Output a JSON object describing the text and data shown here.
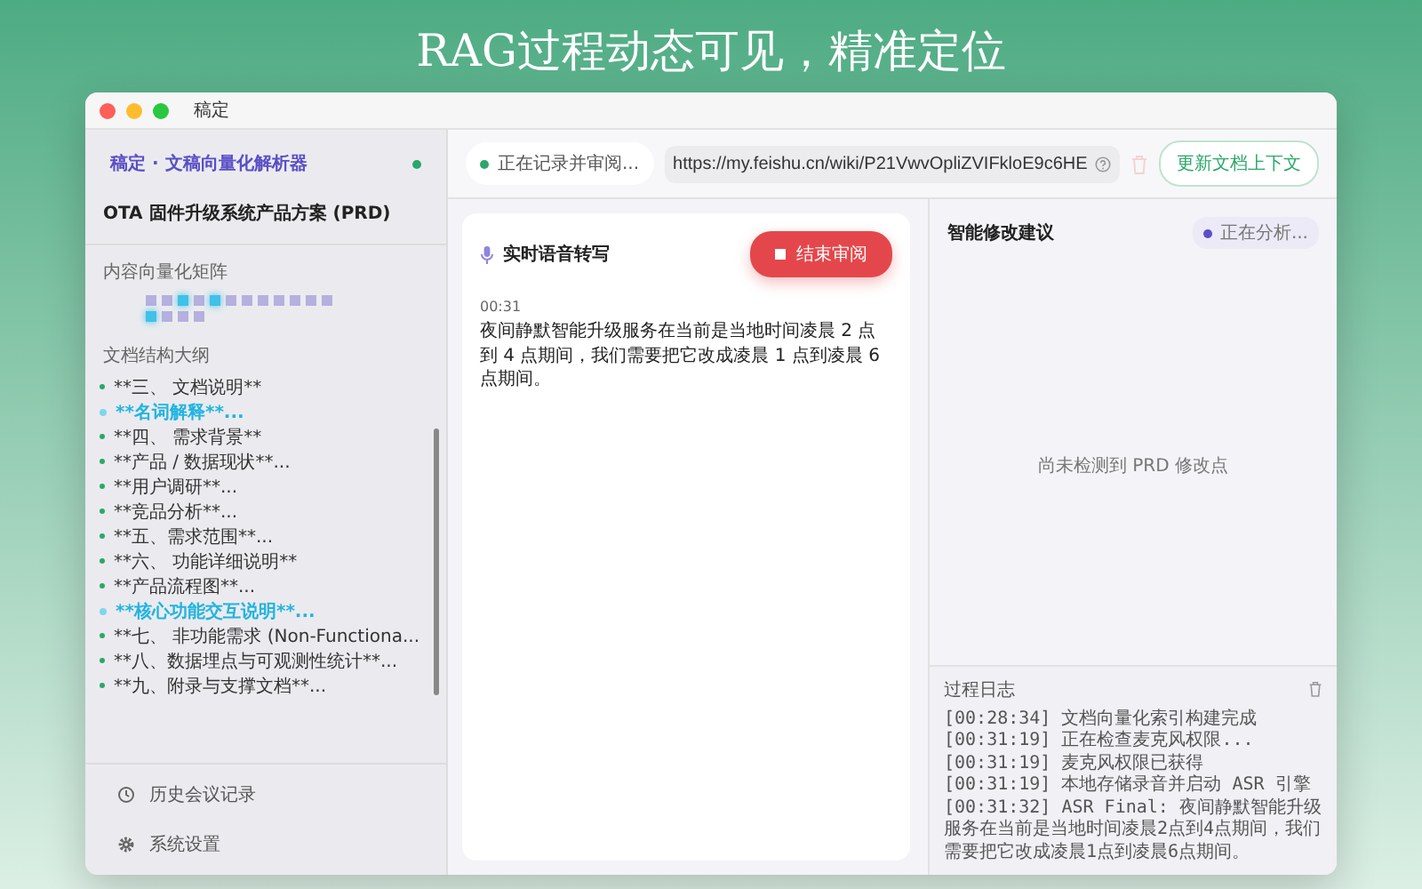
{
  "headline": "RAG过程动态可见，精准定位",
  "window": {
    "title": "稿定"
  },
  "sidebar": {
    "app_label": "稿定 · 文稿向量化解析器",
    "online": true,
    "doc_title": "OTA 固件升级系统产品方案 (PRD)",
    "matrix": {
      "title": "内容向量化矩阵",
      "cells": [
        {
          "active": false
        },
        {
          "active": false
        },
        {
          "active": true
        },
        {
          "active": false
        },
        {
          "active": true
        },
        {
          "active": false
        },
        {
          "active": false
        },
        {
          "active": false
        },
        {
          "active": false
        },
        {
          "active": false
        },
        {
          "active": false
        },
        {
          "active": false
        },
        {
          "active": true
        },
        {
          "active": false
        },
        {
          "active": false
        },
        {
          "active": false
        }
      ]
    },
    "outline": {
      "title": "文档结构大纲",
      "items": [
        {
          "label": "**三、 文档说明**",
          "selected": false
        },
        {
          "label": "**名词解释**...",
          "selected": true
        },
        {
          "label": "**四、 需求背景**",
          "selected": false
        },
        {
          "label": "**产品 / 数据现状**...",
          "selected": false
        },
        {
          "label": "**用户调研**...",
          "selected": false
        },
        {
          "label": "**竞品分析**...",
          "selected": false
        },
        {
          "label": "**五、需求范围**...",
          "selected": false
        },
        {
          "label": "**六、 功能详细说明**",
          "selected": false
        },
        {
          "label": "**产品流程图**...",
          "selected": false
        },
        {
          "label": "**核心功能交互说明**...",
          "selected": true
        },
        {
          "label": "**七、 非功能需求 (Non-Functiona...",
          "selected": false
        },
        {
          "label": "**八、数据埋点与可观测性统计**...",
          "selected": false
        },
        {
          "label": "**九、附录与支撑文档**...",
          "selected": false
        }
      ]
    },
    "nav": [
      {
        "kind": "history",
        "label": "历史会议记录"
      },
      {
        "kind": "settings",
        "label": "系统设置"
      }
    ]
  },
  "toolbar": {
    "status": "正在记录并审阅...",
    "url": "https://my.feishu.cn/wiki/P21VwvOpliZVIFkloE9c6HE",
    "update_button": "更新文档上下文"
  },
  "transcript": {
    "title": "实时语音转写",
    "stop_button": "结束审阅",
    "time": "00:31",
    "text": "夜间静默智能升级服务在当前是当地时间凌晨 2 点到 4 点期间，我们需要把它改成凌晨 1 点到凌晨 6 点期间。"
  },
  "suggestions": {
    "title": "智能修改建议",
    "status": "正在分析...",
    "empty": "尚未检测到 PRD 修改点"
  },
  "log": {
    "title": "过程日志",
    "lines": [
      "[00:28:34] 文档向量化索引构建完成",
      "[00:31:19] 正在检查麦克风权限...",
      "[00:31:19] 麦克风权限已获得",
      "[00:31:19] 本地存储录音并启动 ASR 引擎",
      "[00:31:32] ASR Final: 夜间静默智能升级服务在当前是当地时间凌晨2点到4点期间，我们需要把它改成凌晨1点到凌晨6点期间。"
    ]
  }
}
